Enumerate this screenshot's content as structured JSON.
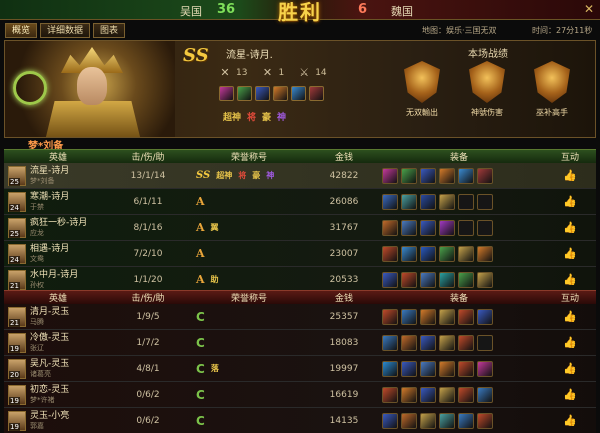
{
  "scorebar": {
    "left_team": "吴国",
    "left_score": "36",
    "center": "胜利",
    "right_score": "6",
    "right_team": "魏国"
  },
  "tabs": [
    "概览",
    "详细数据",
    "图表"
  ],
  "map_info": "地图：娱乐·三国无双",
  "time_info": "时间：27分11秒",
  "banner": {
    "rank": "SS",
    "title": "流星-诗月.",
    "kills": "13",
    "deaths": "1",
    "assists": "14",
    "equip_colors": [
      "#c33a9a",
      "#4aa04a",
      "#3a5ac0",
      "#d27a2a",
      "#3a8ad0",
      "#a03a3a"
    ],
    "honors": [
      {
        "text": "超神",
        "color": "#e6c34a"
      },
      {
        "text": "将",
        "color": "#e04a3a"
      },
      {
        "text": "豪",
        "color": "#e6c34a"
      },
      {
        "text": "神",
        "color": "#a05ae0"
      }
    ],
    "section_title": "本场战绩",
    "medals": [
      "无双輸出",
      "神號伤害",
      "巫补高手"
    ]
  },
  "team_name": "梦*刘备",
  "headers": {
    "hero": "英雄",
    "kda": "击/伤/助",
    "honor": "荣誉称号",
    "gold": "金钱",
    "equip": "装备",
    "act": "互动"
  },
  "team_green": [
    {
      "hero": "流星-诗月",
      "lv": "25",
      "player": "梦*刘备",
      "kda": "13/1/14",
      "rank": "SS",
      "gold": "42822",
      "slots": [
        "#c33a9a",
        "#4aa04a",
        "#3a5ac0",
        "#d27a2a",
        "#3a8ad0",
        "#a03a3a"
      ],
      "honor_extra": [
        "超神",
        "将",
        "豪",
        "神"
      ]
    },
    {
      "hero": "寒潮-诗月",
      "lv": "24",
      "player": "于禁",
      "kda": "6/1/11",
      "rank": "A",
      "gold": "26086",
      "slots": [
        "#3a6ac0",
        "#4aa0a0",
        "#2a4aa0",
        "#c3a04a",
        "#2a2a2a",
        "#2a2a2a"
      ],
      "honor_extra": []
    },
    {
      "hero": "疯狂一秒-诗月",
      "lv": "25",
      "player": "应龙",
      "kda": "8/1/16",
      "rank": "A",
      "gold": "31767",
      "slots": [
        "#c06a2a",
        "#4a7ac0",
        "#3a5ac0",
        "#a03ac0",
        "#2a2a2a",
        "#2a2a2a"
      ],
      "honor_extra": [
        "翼"
      ]
    },
    {
      "hero": "相遇-诗月",
      "lv": "24",
      "player": "文鸯",
      "kda": "7/2/10",
      "rank": "A",
      "gold": "23007",
      "slots": [
        "#c04a2a",
        "#3a8ad0",
        "#2a5ac0",
        "#4aa04a",
        "#c3a04a",
        "#d27a2a"
      ],
      "honor_extra": []
    },
    {
      "hero": "水中月-诗月",
      "lv": "21",
      "player": "孙权",
      "kda": "1/1/20",
      "rank": "A",
      "gold": "20533",
      "slots": [
        "#3a5ac0",
        "#c04a2a",
        "#4a7ac0",
        "#2aa0a0",
        "#4aa04a",
        "#c3a04a"
      ],
      "honor_extra": [
        "助"
      ]
    }
  ],
  "team_red": [
    {
      "hero": "清月-灵玉",
      "lv": "21",
      "player": "马腾",
      "kda": "1/9/5",
      "rank": "C",
      "gold": "25357",
      "slots": [
        "#c04a2a",
        "#3a7ac0",
        "#d27a2a",
        "#c3a04a",
        "#c04a2a",
        "#3a5ac0"
      ],
      "honor_extra": []
    },
    {
      "hero": "冷傲-灵玉",
      "lv": "19",
      "player": "张辽",
      "kda": "1/7/2",
      "rank": "C",
      "gold": "18083",
      "slots": [
        "#3a7ac0",
        "#c06a2a",
        "#3a5ac0",
        "#c3a04a",
        "#c04a2a",
        "#2a2a2a"
      ],
      "honor_extra": []
    },
    {
      "hero": "吴凡-灵玉",
      "lv": "20",
      "player": "诸葛亮",
      "kda": "4/8/1",
      "rank": "C",
      "gold": "19997",
      "slots": [
        "#2a8ad0",
        "#3a5ac0",
        "#4a7ac0",
        "#d27a2a",
        "#c04a2a",
        "#c33a9a"
      ],
      "honor_extra": [
        "落"
      ]
    },
    {
      "hero": "初恋-灵玉",
      "lv": "19",
      "player": "梦*许褚",
      "kda": "0/6/2",
      "rank": "C",
      "gold": "16619",
      "slots": [
        "#c04a2a",
        "#d27a2a",
        "#3a5ac0",
        "#c3a04a",
        "#c04a2a",
        "#3a7ac0"
      ],
      "honor_extra": []
    },
    {
      "hero": "灵玉-小亮",
      "lv": "19",
      "player": "郭嘉",
      "kda": "0/6/2",
      "rank": "C",
      "gold": "14135",
      "slots": [
        "#3a5ac0",
        "#c06a2a",
        "#c3a04a",
        "#4aa0a0",
        "#3a7ac0",
        "#c04a2a"
      ],
      "honor_extra": []
    }
  ]
}
